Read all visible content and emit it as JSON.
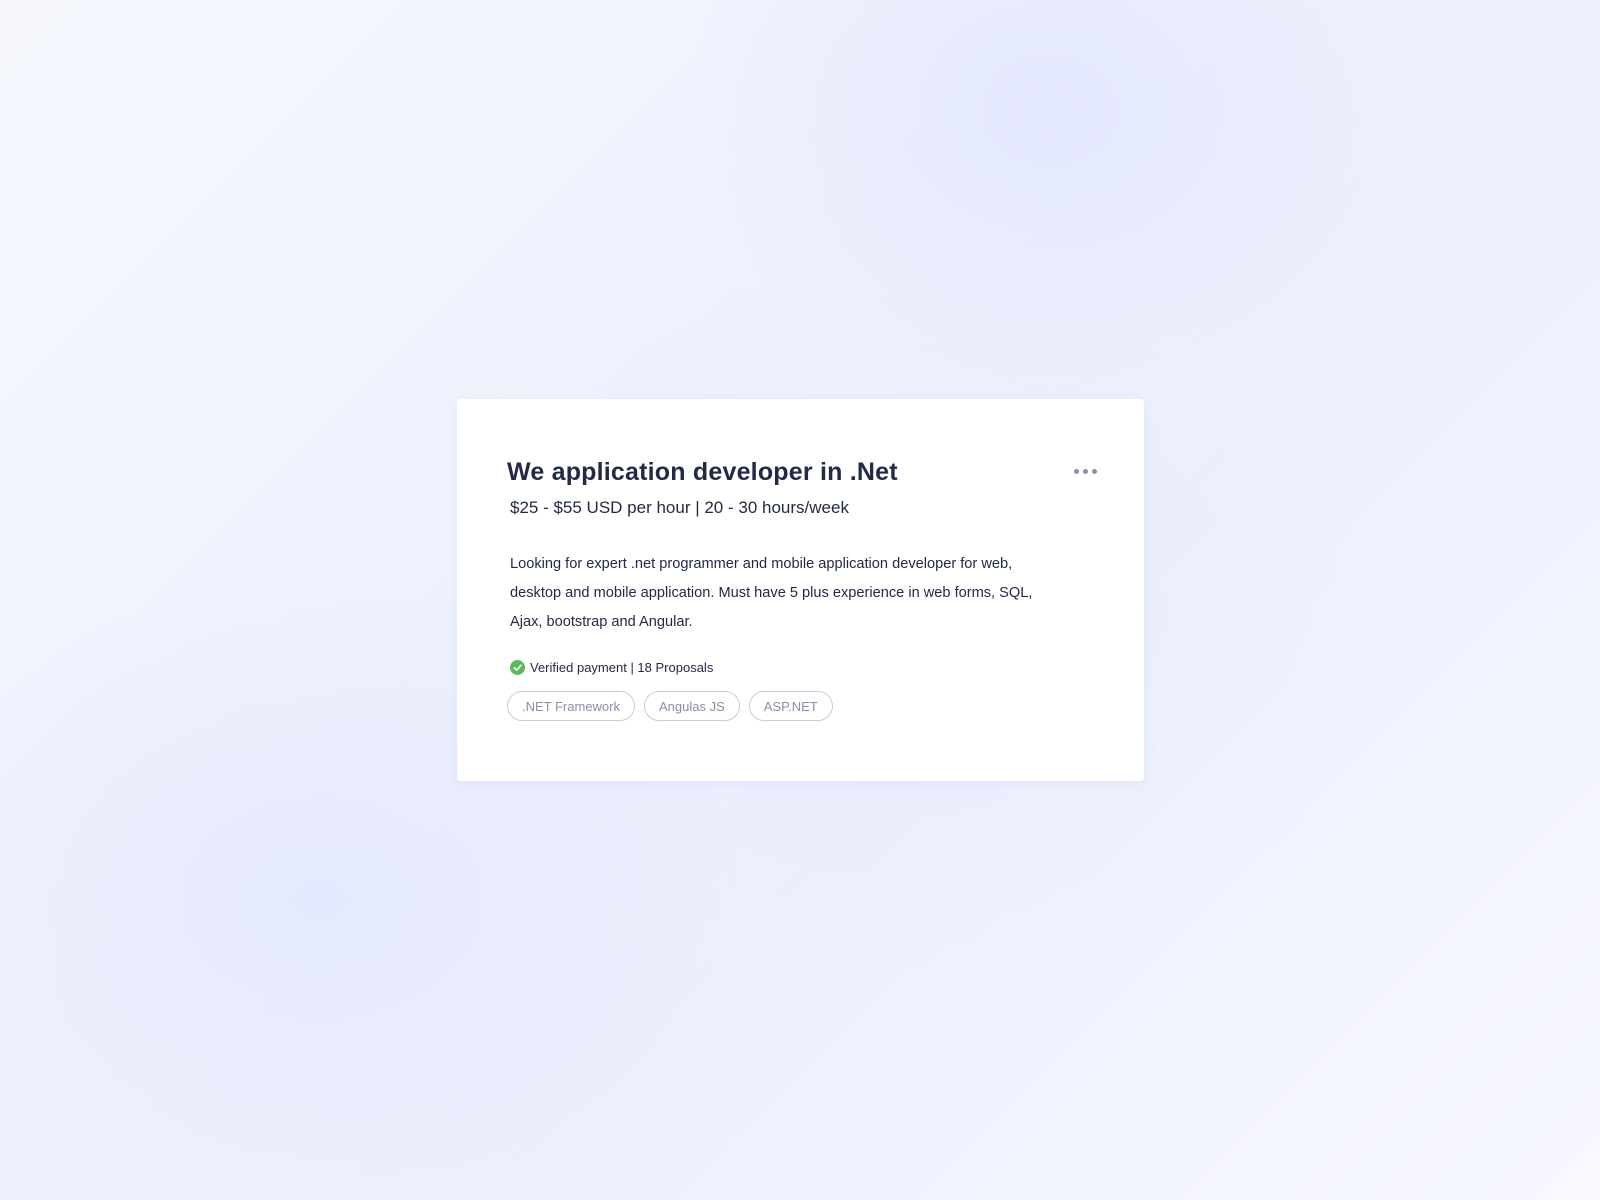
{
  "job": {
    "title": "We application developer in .Net",
    "rate_line": "$25 - $55 USD per hour | 20 - 30 hours/week",
    "description": "Looking for expert .net programmer and mobile application developer for web, desktop and mobile application. Must have 5 plus experience in web forms, SQL, Ajax, bootstrap and Angular.",
    "meta_text": "Verified payment | 18 Proposals",
    "verified_icon": "check-circle-icon",
    "more_icon": "more-horizontal-icon",
    "tags": [
      {
        "label": ".NET Framework"
      },
      {
        "label": "Angulas JS"
      },
      {
        "label": "ASP.NET"
      }
    ]
  },
  "colors": {
    "text_primary": "#232a47",
    "tag_text": "#8b8fa8",
    "verified_green": "#5cb85c",
    "card_bg": "#ffffff"
  }
}
